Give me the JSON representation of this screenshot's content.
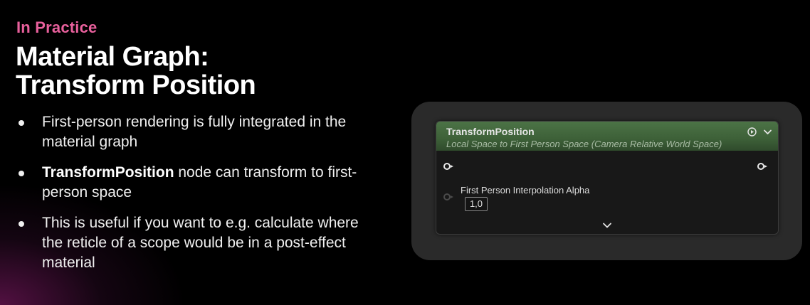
{
  "slide": {
    "eyebrow": "In Practice",
    "title_line1": "Material Graph:",
    "title_line2": "Transform Position",
    "bullets": [
      {
        "bold": "",
        "text": "First-person rendering is fully integrated in the material graph"
      },
      {
        "bold": "TransformPosition",
        "text": " node can transform to first-person space"
      },
      {
        "bold": "",
        "text": "This is useful if you want to e.g. calculate where the reticle of a scope would be in a post-effect material"
      }
    ]
  },
  "node": {
    "title": "TransformPosition",
    "subtitle": "Local Space to First Person Space (Camera Relative World Space)",
    "input_label": "First Person Interpolation Alpha",
    "input_value": "1,0",
    "header_icons": [
      "preview-toggle-icon",
      "collapse-chevron-icon"
    ],
    "expand_icon": "expand-chevron-icon"
  },
  "colors": {
    "eyebrow": "#e8609c",
    "node_header": "#3d6038",
    "background": "#000000",
    "panel": "#2a2a2a"
  }
}
